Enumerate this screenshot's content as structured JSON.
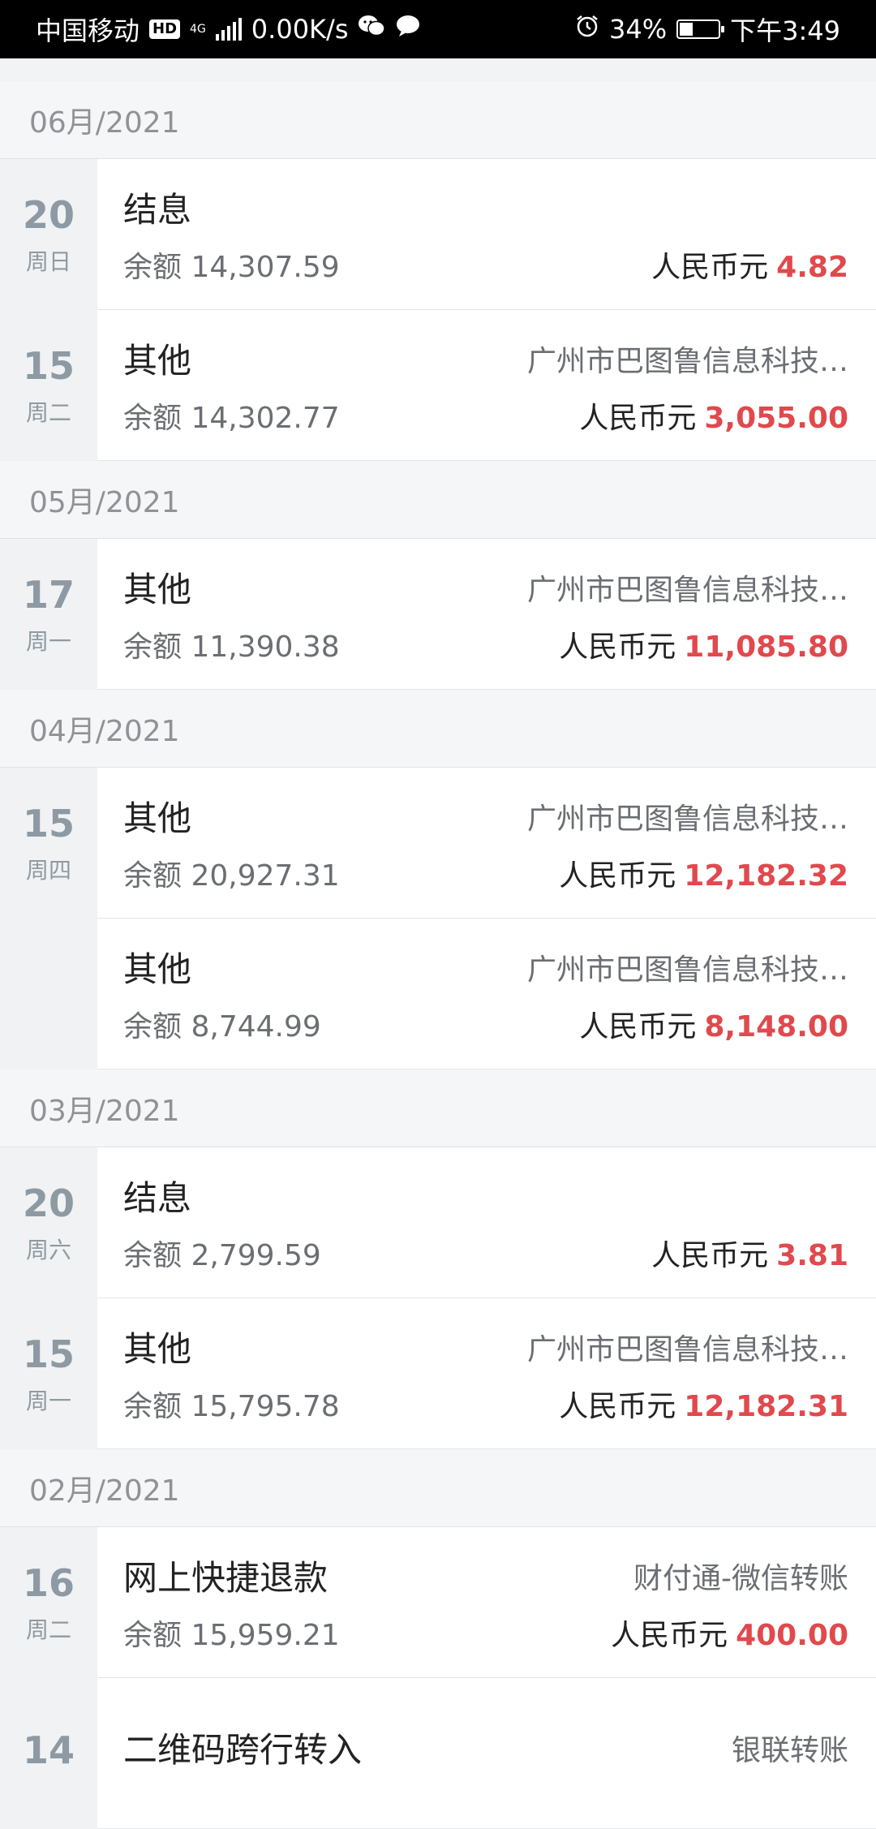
{
  "status_bar": {
    "carrier": "中国移动",
    "hd": "HD",
    "network": "4G",
    "speed": "0.00K/s",
    "battery": "34%",
    "time": "下午3:49"
  },
  "currency_label": "人民币元",
  "balance_label": "余额",
  "months": [
    {
      "label": "06月/2021",
      "days": [
        {
          "day": "20",
          "weekday": "周日",
          "entries": [
            {
              "title": "结息",
              "counterparty": "",
              "balance": "14,307.59",
              "amount": "4.82"
            }
          ]
        },
        {
          "day": "15",
          "weekday": "周二",
          "entries": [
            {
              "title": "其他",
              "counterparty": "广州市巴图鲁信息科技…",
              "balance": "14,302.77",
              "amount": "3,055.00"
            }
          ]
        }
      ]
    },
    {
      "label": "05月/2021",
      "days": [
        {
          "day": "17",
          "weekday": "周一",
          "entries": [
            {
              "title": "其他",
              "counterparty": "广州市巴图鲁信息科技…",
              "balance": "11,390.38",
              "amount": "11,085.80"
            }
          ]
        }
      ]
    },
    {
      "label": "04月/2021",
      "days": [
        {
          "day": "15",
          "weekday": "周四",
          "entries": [
            {
              "title": "其他",
              "counterparty": "广州市巴图鲁信息科技…",
              "balance": "20,927.31",
              "amount": "12,182.32"
            },
            {
              "title": "其他",
              "counterparty": "广州市巴图鲁信息科技…",
              "balance": "8,744.99",
              "amount": "8,148.00"
            }
          ]
        }
      ]
    },
    {
      "label": "03月/2021",
      "days": [
        {
          "day": "20",
          "weekday": "周六",
          "entries": [
            {
              "title": "结息",
              "counterparty": "",
              "balance": "2,799.59",
              "amount": "3.81"
            }
          ]
        },
        {
          "day": "15",
          "weekday": "周一",
          "entries": [
            {
              "title": "其他",
              "counterparty": "广州市巴图鲁信息科技…",
              "balance": "15,795.78",
              "amount": "12,182.31"
            }
          ]
        }
      ]
    },
    {
      "label": "02月/2021",
      "days": [
        {
          "day": "16",
          "weekday": "周二",
          "entries": [
            {
              "title": "网上快捷退款",
              "counterparty": "财付通-微信转账",
              "balance": "15,959.21",
              "amount": "400.00"
            }
          ]
        },
        {
          "day": "14",
          "weekday": "",
          "entries": [
            {
              "title": "二维码跨行转入",
              "counterparty": "银联转账",
              "balance": "",
              "amount": ""
            }
          ]
        }
      ]
    }
  ],
  "colors": {
    "amount": "#e0494d",
    "date": "#8e9aa3",
    "month_header_bg": "#f5f6f7"
  }
}
